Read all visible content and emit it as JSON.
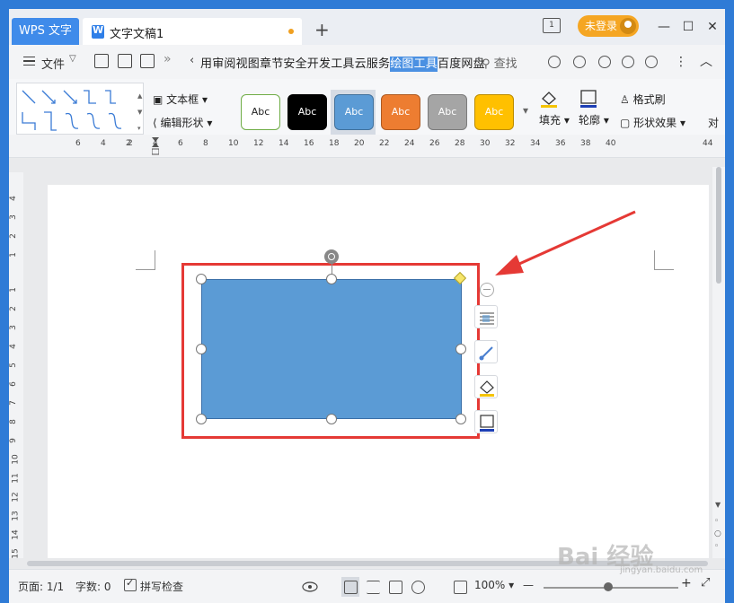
{
  "titlebar": {
    "app_tab": "WPS 文字",
    "doc_tab": "文字文稿1",
    "new_tab": "+",
    "page_count_icon": "1",
    "login_label": "未登录",
    "minimize": "—",
    "maximize": "☐",
    "close": "✕"
  },
  "menubar": {
    "file_label": "文件",
    "overflow": "»",
    "back": "‹",
    "tabs_before": "用审阅视图章节安全开发工具云服务",
    "active_tab": "绘图工具",
    "tabs_after": "百度网盘",
    "search": "查找"
  },
  "toolbar": {
    "text_box": "文本框",
    "edit_shape": "编辑形状",
    "styles": [
      {
        "label": "Abc",
        "bg": "#ffffff",
        "border": "#70ad47",
        "color": "#222222"
      },
      {
        "label": "Abc",
        "bg": "#000000",
        "border": "#000000",
        "color": "#ffffff"
      },
      {
        "label": "Abc",
        "bg": "#5b9bd5",
        "border": "#41719c",
        "color": "#ffffff"
      },
      {
        "label": "Abc",
        "bg": "#ed7d31",
        "border": "#ae5a21",
        "color": "#ffffff"
      },
      {
        "label": "Abc",
        "bg": "#a5a5a5",
        "border": "#7b7b7b",
        "color": "#ffffff"
      },
      {
        "label": "Abc",
        "bg": "#ffc000",
        "border": "#bc8c00",
        "color": "#ffffff"
      }
    ],
    "fill": "填充",
    "outline": "轮廓",
    "format_painter": "格式刷",
    "shape_effects": "形状效果",
    "cut_off": "对"
  },
  "ruler_h": [
    "6",
    "4",
    "2",
    "2",
    "4",
    "6",
    "8",
    "10",
    "12",
    "14",
    "16",
    "18",
    "20",
    "22",
    "24",
    "26",
    "28",
    "30",
    "32",
    "34",
    "36",
    "38",
    "40",
    "44"
  ],
  "ruler_v": [
    "4",
    "3",
    "2",
    "1",
    "1",
    "2",
    "3",
    "4",
    "5",
    "6",
    "7",
    "8",
    "9",
    "10",
    "11",
    "12",
    "13",
    "14",
    "15"
  ],
  "statusbar": {
    "page": "页面: 1/1",
    "words": "字数: 0",
    "spell_check": "拼写检查",
    "zoom": "100%",
    "zoom_minus": "—",
    "zoom_plus": "+"
  },
  "colors": {
    "accent": "#4a90e2",
    "shape_fill": "#5b9bd5",
    "highlight_red": "#e53935",
    "login_orange": "#f5a623"
  },
  "watermark": {
    "brand": "Bai 经验",
    "sub": "jingyan.baidu.com"
  }
}
